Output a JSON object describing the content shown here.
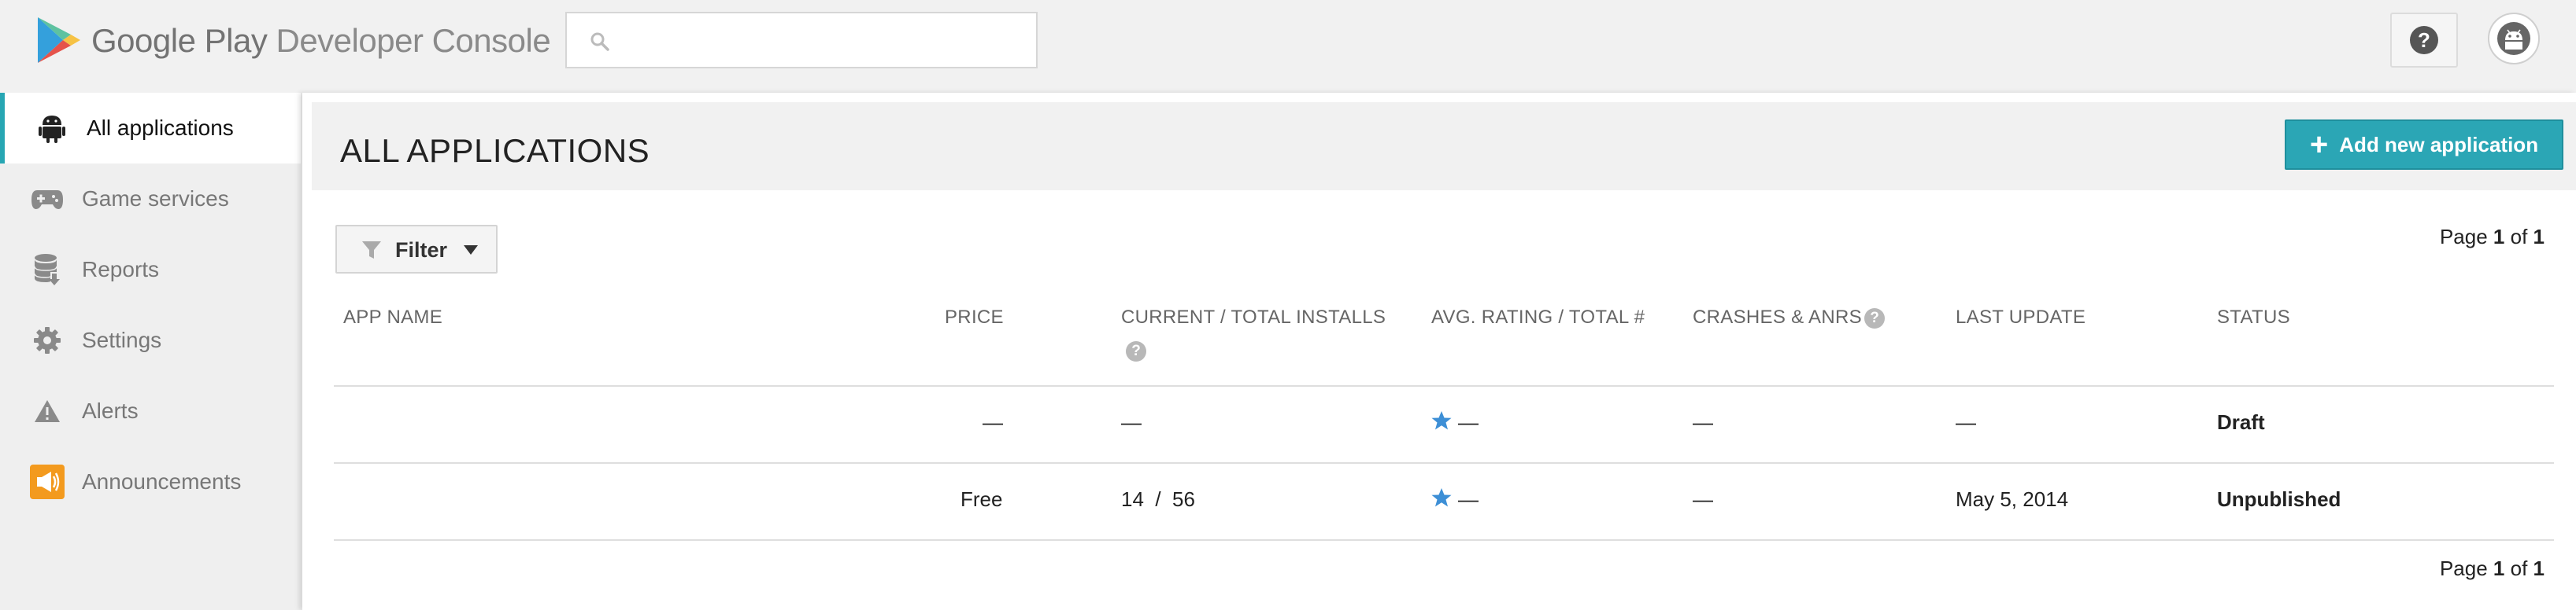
{
  "header": {
    "brand_google": "Google",
    "brand_play": "Play",
    "brand_console": "Developer Console",
    "search_value": "",
    "search_placeholder": "",
    "help_glyph": "?"
  },
  "sidebar": {
    "items": [
      {
        "label": "All applications",
        "icon": "android-icon",
        "active": true
      },
      {
        "label": "Game services",
        "icon": "gamepad-icon",
        "active": false
      },
      {
        "label": "Reports",
        "icon": "database-download-icon",
        "active": false
      },
      {
        "label": "Settings",
        "icon": "gear-icon",
        "active": false
      },
      {
        "label": "Alerts",
        "icon": "warning-icon",
        "active": false
      },
      {
        "label": "Announcements",
        "icon": "megaphone-icon",
        "active": false
      }
    ]
  },
  "main": {
    "title": "ALL APPLICATIONS",
    "add_button_label": "Add new application",
    "add_button_plus": "+",
    "filter_label": "Filter",
    "pager_top": {
      "prefix": "Page ",
      "current": "1",
      "sep": " of ",
      "total": "1"
    },
    "pager_bottom": {
      "prefix": "Page ",
      "current": "1",
      "sep": " of ",
      "total": "1"
    },
    "columns": [
      "APP NAME",
      "PRICE",
      "CURRENT / TOTAL INSTALLS",
      "AVG. RATING / TOTAL #",
      "CRASHES & ANRS",
      "LAST UPDATE",
      "STATUS"
    ],
    "rows": [
      {
        "app_name": "",
        "price": "—",
        "installs": "—",
        "rating": "—",
        "crashes": "—",
        "last_update": "—",
        "status": "Draft"
      },
      {
        "app_name": "",
        "price": "Free",
        "installs": "14  /  56",
        "rating": "—",
        "crashes": "—",
        "last_update": "May 5, 2014",
        "status": "Unpublished"
      }
    ]
  },
  "colors": {
    "accent": "#27a6b3",
    "add_button": "#2ba6b5",
    "star": "#3d8fd6",
    "announcement_icon": "#f39a1e"
  }
}
